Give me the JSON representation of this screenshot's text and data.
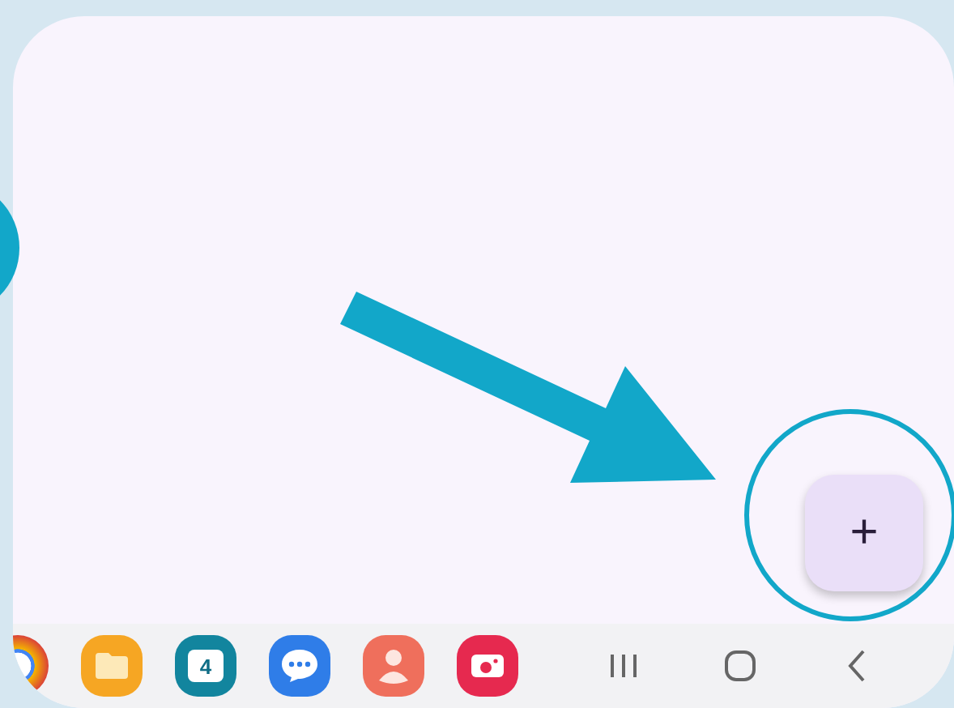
{
  "fab": {
    "label": "+"
  },
  "dock": [
    {
      "kind": "chrome"
    },
    {
      "kind": "files"
    },
    {
      "kind": "calendar",
      "label": "4"
    },
    {
      "kind": "messages"
    },
    {
      "kind": "contacts"
    },
    {
      "kind": "camera"
    }
  ],
  "nav": [
    {
      "kind": "recents"
    },
    {
      "kind": "home"
    },
    {
      "kind": "back"
    }
  ]
}
